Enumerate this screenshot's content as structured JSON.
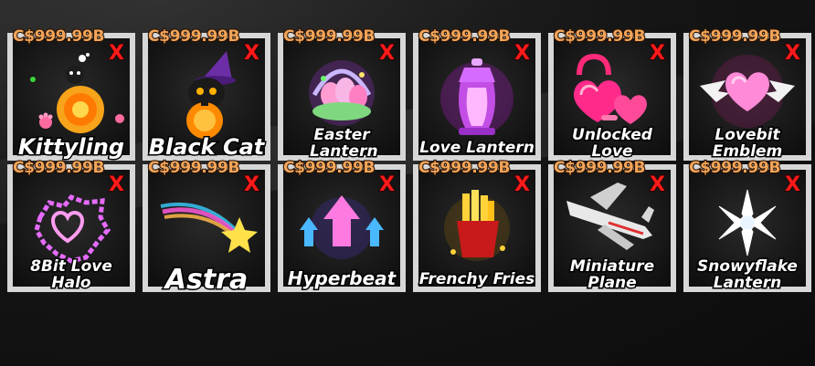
{
  "colors": {
    "price": "#f2a55a",
    "close": "#ff1a1a",
    "tile_border": "#d7d7d7",
    "name": "#ffffff"
  },
  "items": [
    {
      "price": "C$999.99B",
      "name": "Kittyling",
      "close": "X",
      "icon": "kittyling-pet-icon"
    },
    {
      "price": "C$999.99B",
      "name": "Black Cat",
      "close": "X",
      "icon": "black-cat-pet-icon"
    },
    {
      "price": "C$999.99B",
      "name": "Easter Lantern",
      "close": "X",
      "icon": "easter-lantern-icon"
    },
    {
      "price": "C$999.99B",
      "name": "Love Lantern",
      "close": "X",
      "icon": "love-lantern-icon"
    },
    {
      "price": "C$999.99B",
      "name": "Unlocked Love",
      "close": "X",
      "icon": "unlocked-love-icon"
    },
    {
      "price": "C$999.99B",
      "name": "Lovebit Emblem",
      "close": "X",
      "icon": "lovebit-emblem-icon"
    },
    {
      "price": "C$999.99B",
      "name": "8Bit Love Halo",
      "close": "X",
      "icon": "8bit-love-halo-icon"
    },
    {
      "price": "C$999.99B",
      "name": "Astra",
      "close": "X",
      "icon": "astra-shooting-star-icon"
    },
    {
      "price": "C$999.99B",
      "name": "Hyperbeat",
      "close": "X",
      "icon": "hyperbeat-arrows-icon"
    },
    {
      "price": "C$999.99B",
      "name": "Frenchy Fries",
      "close": "X",
      "icon": "frenchy-fries-icon"
    },
    {
      "price": "C$999.99B",
      "name": "Miniature Plane",
      "close": "X",
      "icon": "miniature-plane-icon"
    },
    {
      "price": "C$999.99B",
      "name": "Snowyflake Lantern",
      "close": "X",
      "icon": "snowyflake-lantern-icon"
    }
  ]
}
